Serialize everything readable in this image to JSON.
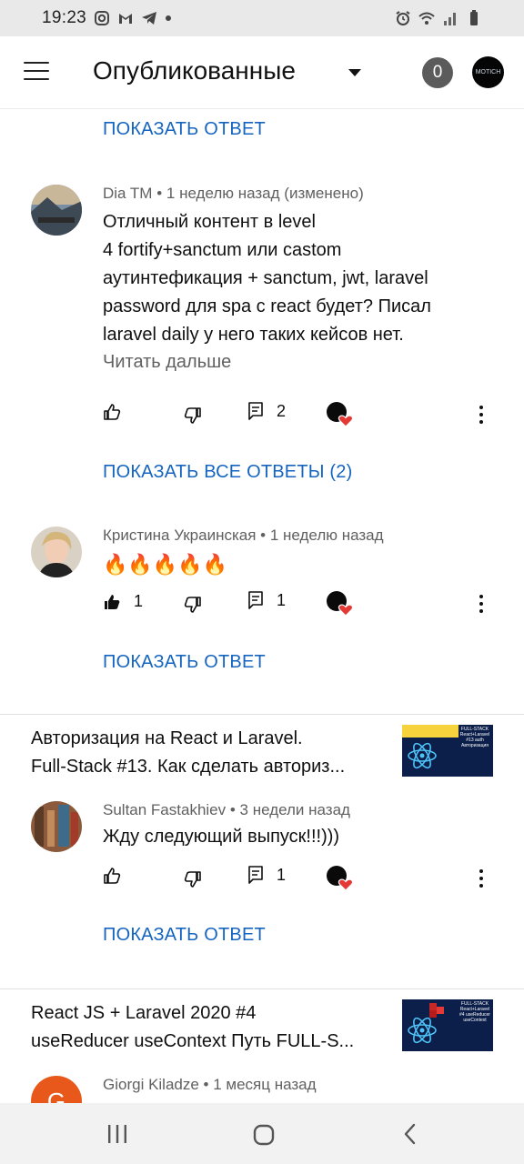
{
  "status_bar": {
    "time": "19:23"
  },
  "header": {
    "title": "Опубликованные",
    "notification_count": "0",
    "channel_avatar_text": "MOTICH"
  },
  "comments": [
    {
      "show_reply_label": "ПОКАЗАТЬ ОТВЕТ"
    },
    {
      "author": "Dia TM",
      "time": "1 неделю назад (изменено)",
      "text_lines": [
        "Отличный контент в level",
        "4  fortify+sanctum или castom",
        "аутинтефикация + sanctum, jwt, laravel",
        "password для spa с react будет? Писал",
        "laravel daily у него таких кейсов нет."
      ],
      "read_more": "Читать дальше",
      "likes": "",
      "replies": "2",
      "show_replies_label": "ПОКАЗАТЬ ВСЕ ОТВЕТЫ (2)"
    },
    {
      "author": "Кристина Украинская",
      "time": "1 неделю назад",
      "text": "🔥🔥🔥🔥🔥",
      "likes": "1",
      "replies": "1",
      "show_reply_label": "ПОКАЗАТЬ ОТВЕТ"
    }
  ],
  "videos": [
    {
      "title_lines": [
        "Авторизация на React и Laravel.",
        "Full-Stack #13. Как сделать авториз..."
      ],
      "thumb_text": [
        "FULL-STACK",
        "React+Laravel",
        "#13 auth",
        "Авторизация"
      ],
      "comment": {
        "author": "Sultan Fastakhiev",
        "time": "3 недели назад",
        "text": "Жду следующий выпуск!!!)))",
        "likes": "",
        "replies": "1",
        "show_reply_label": "ПОКАЗАТЬ ОТВЕТ"
      }
    },
    {
      "title_lines": [
        "React JS + Laravel 2020 #4",
        "useReducer useContext Путь FULL-S..."
      ],
      "thumb_text": [
        "FULL-STACK",
        "React+Laravel",
        "#4 useReducer",
        "useContext"
      ],
      "comment": {
        "author": "Giorgi Kiladze",
        "time": "1 месяц назад",
        "avatar_letter": "G"
      }
    }
  ],
  "colors": {
    "link": "#1565c0",
    "meta": "#606060",
    "heart": "#e53935",
    "avatar_orange": "#e8581a"
  }
}
